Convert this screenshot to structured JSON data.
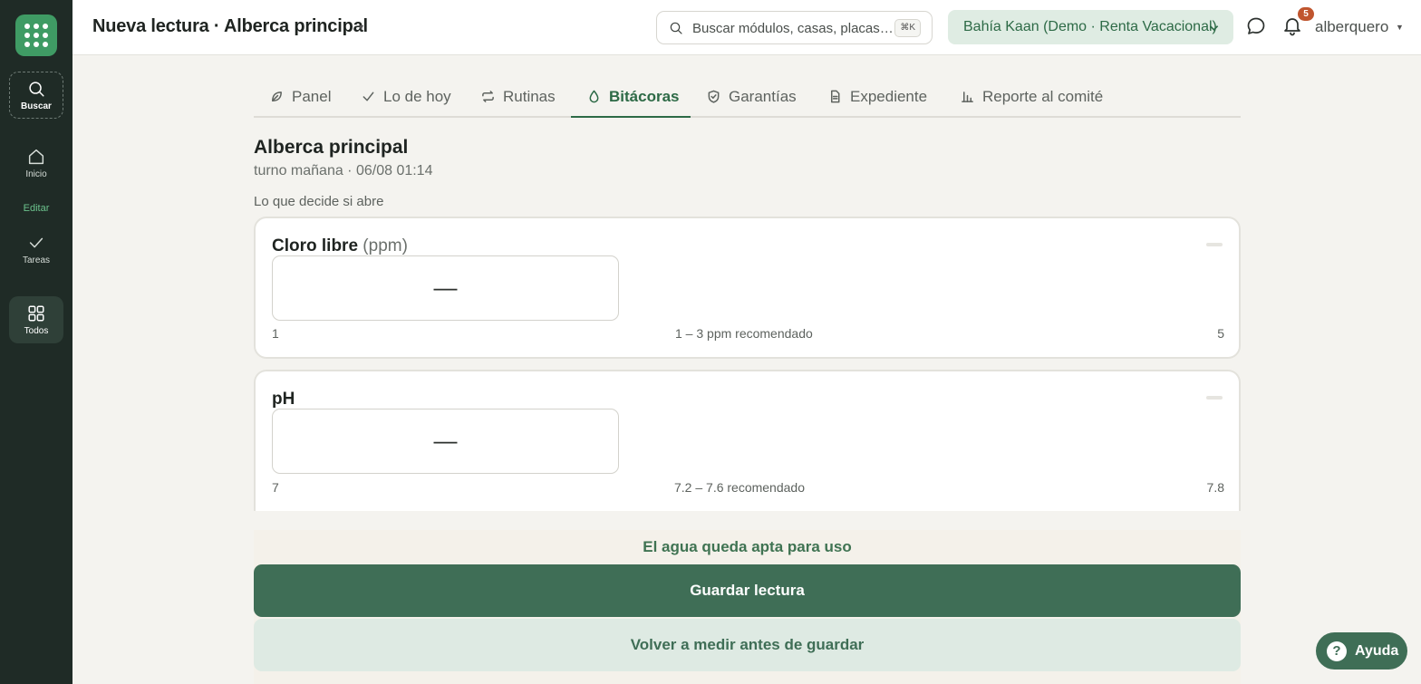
{
  "sidebar": {
    "logo_icon": "apps-grid-icon",
    "search_label": "Buscar",
    "home_label": "Inicio",
    "edit_label": "Editar",
    "tasks_label": "Tareas",
    "all_label": "Todos"
  },
  "header": {
    "title": "Nueva lectura · Alberca principal",
    "search_placeholder": "Buscar módulos, casas, placas…",
    "search_shortcut": "⌘K",
    "org_selector": "Bahía Kaan (Demo · Renta Vacacional)",
    "notification_count": "5",
    "username": "alberquero"
  },
  "tabs": [
    {
      "label": "Panel",
      "icon": "leaf-icon"
    },
    {
      "label": "Lo de hoy",
      "icon": "check-icon"
    },
    {
      "label": "Rutinas",
      "icon": "repeat-icon"
    },
    {
      "label": "Bitácoras",
      "icon": "droplet-icon",
      "active": true
    },
    {
      "label": "Garantías",
      "icon": "shield-check-icon"
    },
    {
      "label": "Expediente",
      "icon": "document-icon"
    },
    {
      "label": "Reporte al comité",
      "icon": "bar-chart-icon"
    }
  ],
  "reading": {
    "title": "Alberca principal",
    "subtitle": "turno mañana · 06/08 01:14",
    "section_label": "Lo que decide si abre"
  },
  "parameters": [
    {
      "name": "Cloro libre",
      "unit": "(ppm)",
      "value": "—",
      "min": "1",
      "recommended": "1 – 3 ppm recomendado",
      "max": "5"
    },
    {
      "name": "pH",
      "unit": "",
      "value": "—",
      "min": "7",
      "recommended": "7.2 – 7.6 recomendado",
      "max": "7.8"
    }
  ],
  "footer": {
    "verdict": "El agua queda apta para uso",
    "save_button": "Guardar lectura",
    "remeasure_button": "Volver a medir antes de guardar"
  },
  "help": {
    "icon": "?",
    "label": "Ayuda"
  },
  "colors": {
    "sidebar_bg": "#1f2b26",
    "accent": "#3f6e56",
    "brand_green": "#3f9b64",
    "badge": "#c0552e"
  }
}
